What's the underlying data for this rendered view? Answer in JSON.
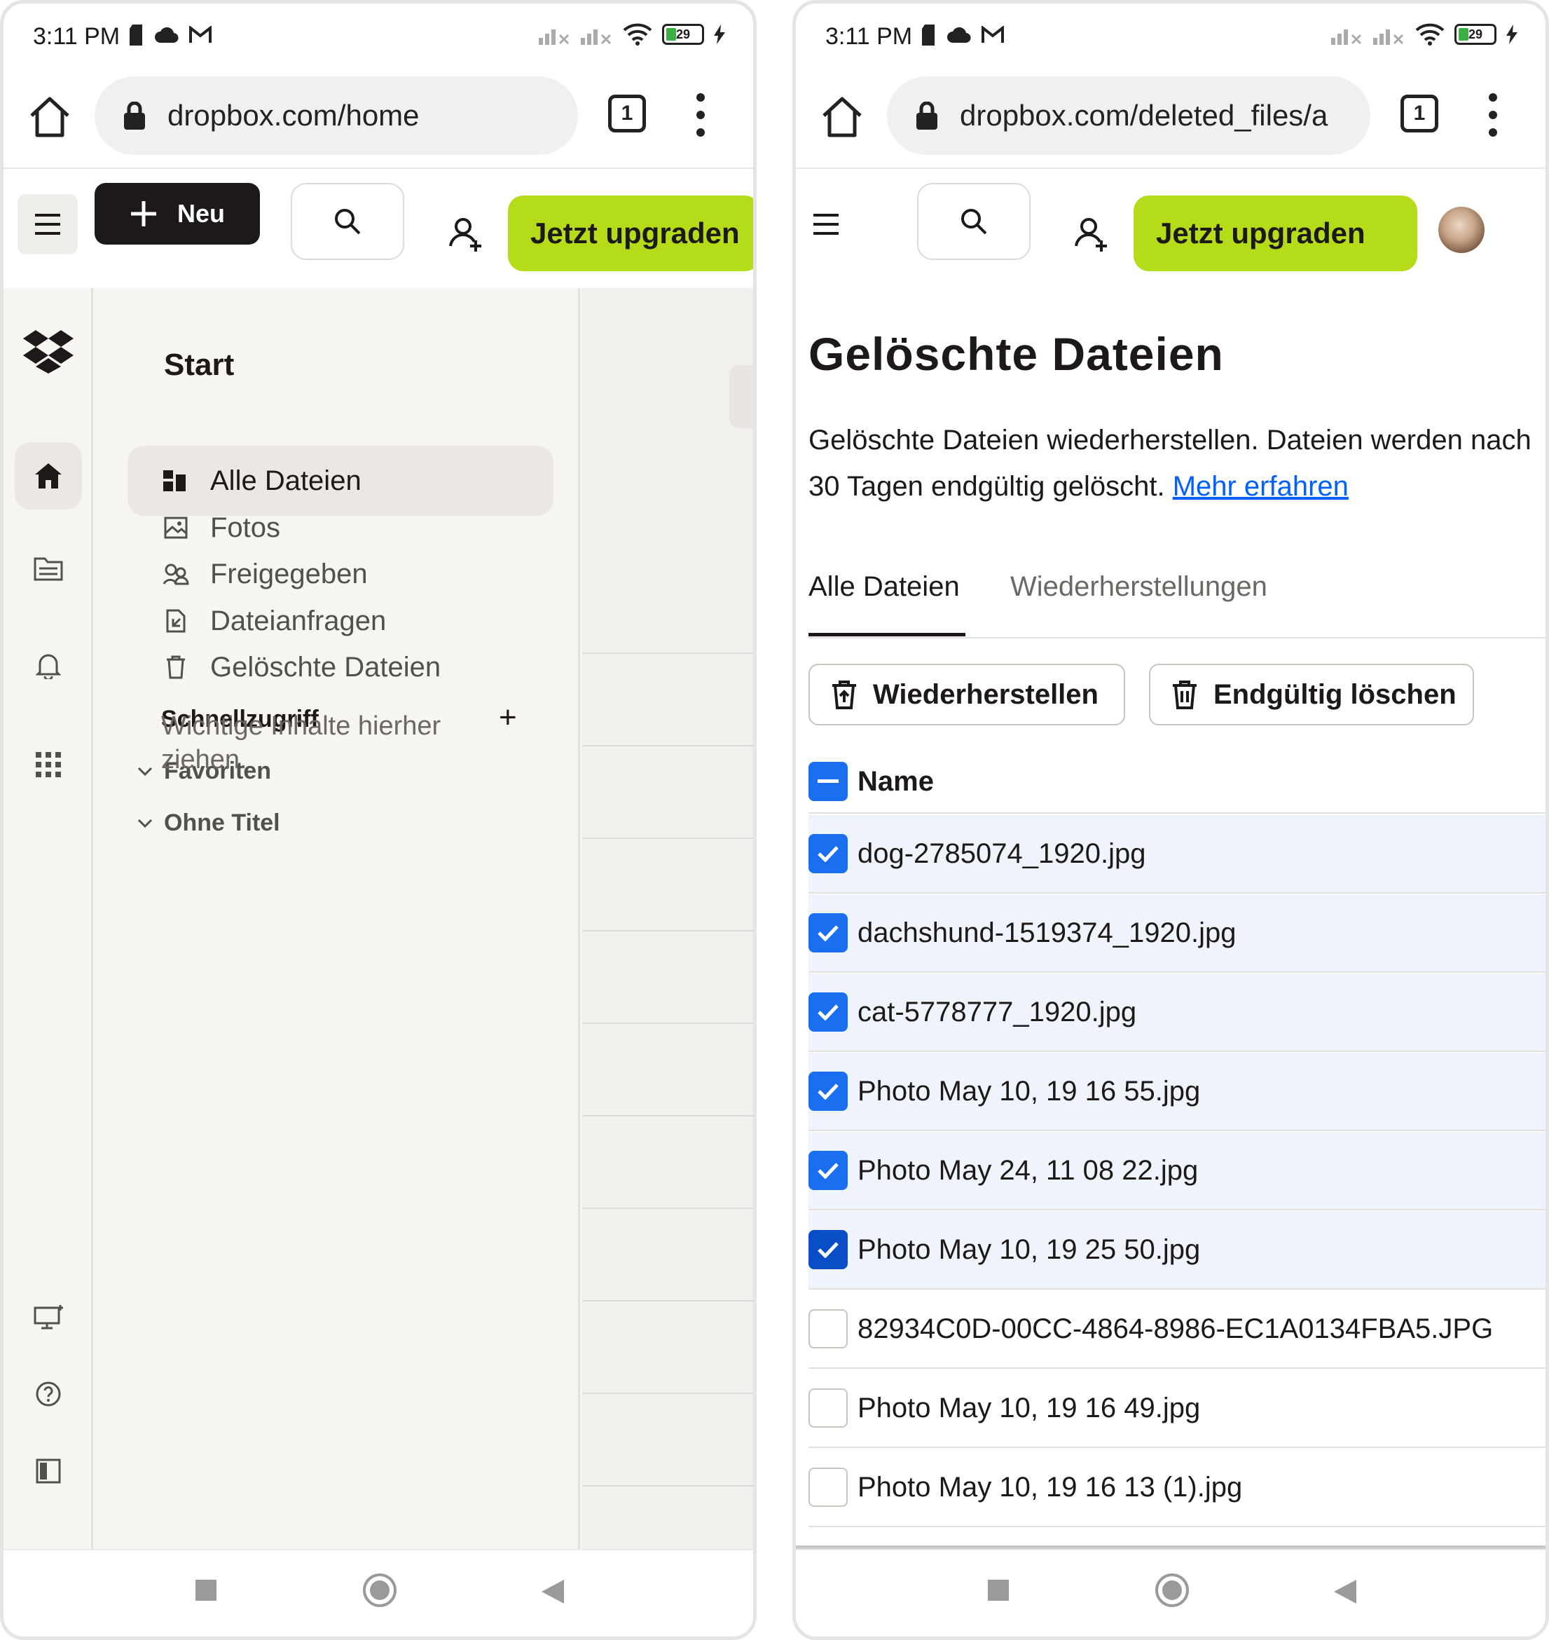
{
  "left": {
    "status": {
      "time": "3:11 PM",
      "battery": "29"
    },
    "browser": {
      "url": "dropbox.com/home",
      "tab_count": "1"
    },
    "header": {
      "new_label": "Neu",
      "upgrade_label": "Jetzt upgraden"
    },
    "panel": {
      "title": "Start",
      "nav": [
        {
          "label": "Alle Dateien",
          "icon": "all-files-icon"
        },
        {
          "label": "Fotos",
          "icon": "photos-icon"
        },
        {
          "label": "Freigegeben",
          "icon": "shared-icon"
        },
        {
          "label": "Dateianfragen",
          "icon": "file-requests-icon"
        },
        {
          "label": "Gelöschte Dateien",
          "icon": "trash-icon"
        }
      ],
      "quick_access_title": "Schnellzugriff",
      "add_symbol": "+",
      "folders": [
        {
          "label": "Favoriten"
        },
        {
          "label": "Ohne Titel"
        }
      ],
      "drop_hint": "Wichtige Inhalte hierher ziehen."
    }
  },
  "right": {
    "status": {
      "time": "3:11 PM",
      "battery": "29"
    },
    "browser": {
      "url": "dropbox.com/deleted_files/a",
      "tab_count": "1"
    },
    "header": {
      "upgrade_label": "Jetzt upgraden"
    },
    "page": {
      "title": "Gelöschte Dateien",
      "description": "Gelöschte Dateien wiederherstellen. Dateien werden nach 30 Tagen endgültig gelöscht.",
      "learn_more": "Mehr erfahren",
      "tabs": [
        {
          "label": "Alle Dateien"
        },
        {
          "label": "Wiederherstellungen"
        }
      ],
      "restore_label": "Wiederherstellen",
      "delete_label": "Endgültig löschen",
      "name_header": "Name",
      "files": [
        {
          "name": "dog-2785074_1920.jpg",
          "selected": true
        },
        {
          "name": "dachshund-1519374_1920.jpg",
          "selected": true
        },
        {
          "name": "cat-5778777_1920.jpg",
          "selected": true
        },
        {
          "name": "Photo May 10, 19 16 55.jpg",
          "selected": true
        },
        {
          "name": "Photo May 24, 11 08 22.jpg",
          "selected": true
        },
        {
          "name": "Photo May 10, 19 25 50.jpg",
          "selected": true
        },
        {
          "name": "82934C0D-00CC-4864-8986-EC1A0134FBA5.JPG",
          "selected": false
        },
        {
          "name": "Photo May 10, 19 16 49.jpg",
          "selected": false
        },
        {
          "name": "Photo May 10, 19 16 13 (1).jpg",
          "selected": false
        }
      ]
    }
  },
  "colors": {
    "upgrade": "#b4dc19",
    "checkbox": "#1a6ff0",
    "link": "#0061fe",
    "selected_row": "#eef3fc"
  }
}
